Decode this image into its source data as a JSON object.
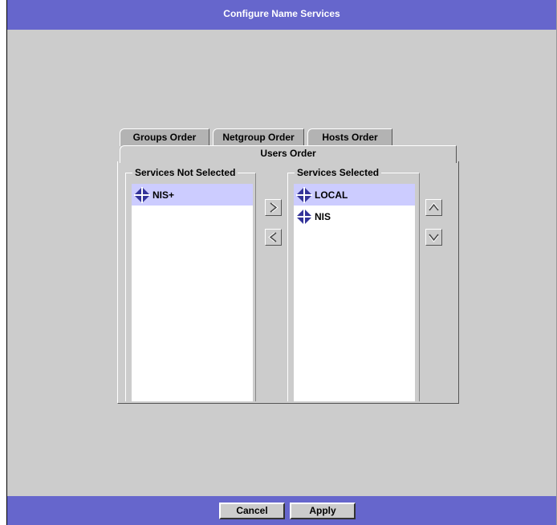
{
  "window": {
    "title": "Configure Name Services"
  },
  "tabs": [
    "Groups Order",
    "Netgroup Order",
    "Hosts Order",
    "Users Order"
  ],
  "not_selected": {
    "legend": "Services Not Selected",
    "items": [
      {
        "label": "NIS+",
        "icon": "service-diamond-icon",
        "selected": true
      }
    ]
  },
  "selected": {
    "legend": "Services Selected",
    "items": [
      {
        "label": "LOCAL",
        "icon": "service-diamond-icon",
        "selected": true
      },
      {
        "label": "NIS",
        "icon": "service-diamond-icon",
        "selected": false
      }
    ]
  },
  "buttons": {
    "cancel": "Cancel",
    "apply": "Apply"
  },
  "colors": {
    "bar": "#6666cc",
    "panel": "#cccccc",
    "selection": "#ccccff",
    "icon": "#333399"
  }
}
